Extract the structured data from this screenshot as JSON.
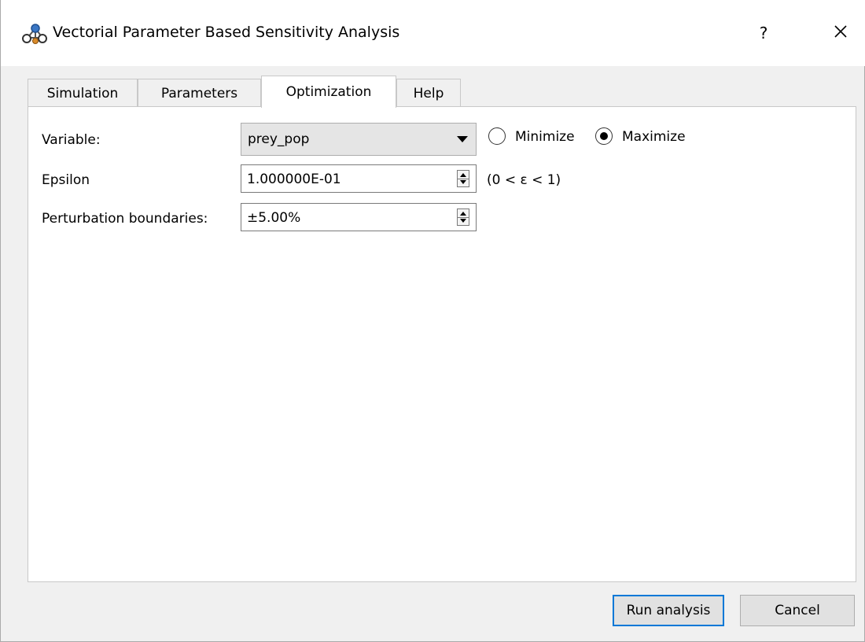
{
  "window": {
    "title": "Vectorial Parameter Based Sensitivity Analysis",
    "icon": "network-nodes-icon",
    "help_label": "?",
    "close_icon": "close-icon"
  },
  "tabs": [
    {
      "label": "Simulation",
      "active": false
    },
    {
      "label": "Parameters",
      "active": false
    },
    {
      "label": "Optimization",
      "active": true
    },
    {
      "label": "Help",
      "active": false
    }
  ],
  "optimization": {
    "variable_label": "Variable:",
    "variable_value": "prey_pop",
    "minimize_label": "Minimize",
    "maximize_label": "Maximize",
    "selected_goal": "Maximize",
    "epsilon_label": "Epsilon",
    "epsilon_value": "1.000000E-01",
    "epsilon_hint": "(0 < ε < 1)",
    "perturbation_label": "Perturbation boundaries:",
    "perturbation_value": "±5.00%"
  },
  "buttons": {
    "run_label": "Run analysis",
    "cancel_label": "Cancel"
  },
  "colors": {
    "accent": "#0078d7",
    "panel_bg": "#ffffff",
    "window_bg": "#f0f0f0"
  }
}
